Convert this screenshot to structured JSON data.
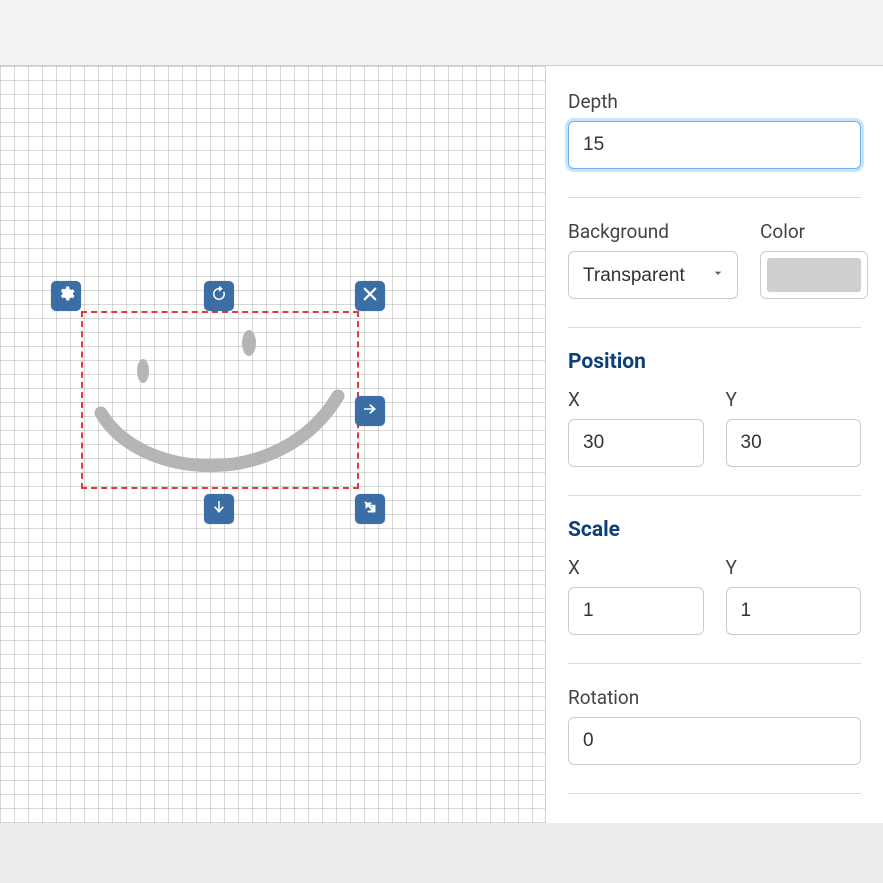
{
  "depth": {
    "label": "Depth",
    "value": "15"
  },
  "background": {
    "label": "Background",
    "selected": "Transparent",
    "color_label": "Color",
    "color_value": "#cfcfcf"
  },
  "position": {
    "title": "Position",
    "x_label": "X",
    "y_label": "Y",
    "x": "30",
    "y": "30"
  },
  "scale": {
    "title": "Scale",
    "x_label": "X",
    "y_label": "Y",
    "x": "1",
    "y": "1"
  },
  "rotation": {
    "label": "Rotation",
    "value": "0"
  },
  "handles": {
    "gear": "gear-icon",
    "rotate": "rotate-cw-icon",
    "close": "close-icon",
    "right": "arrow-right-icon",
    "down": "arrow-down-icon",
    "diag": "arrow-diag-icon"
  }
}
